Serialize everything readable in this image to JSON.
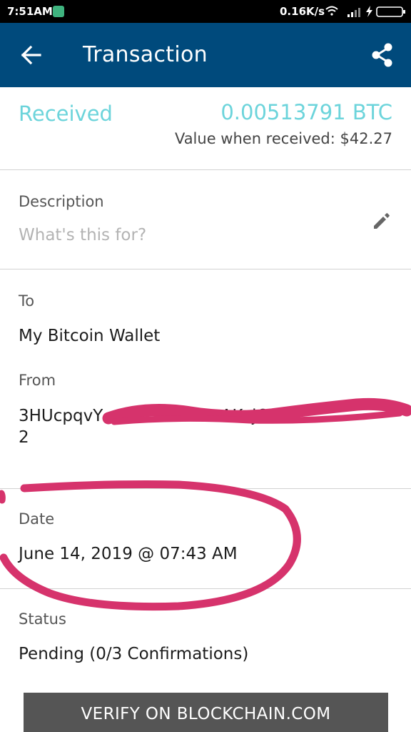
{
  "status_bar": {
    "time": "7:51AM",
    "network_speed": "0.16K/s",
    "icons": [
      "wifi-icon",
      "signal-icon",
      "charging-icon",
      "battery-icon"
    ]
  },
  "app_bar": {
    "title": "Transaction",
    "back_icon": "arrow-left-icon",
    "share_icon": "share-icon",
    "color": "#004a7c"
  },
  "summary": {
    "direction": "Received",
    "amount": "0.00513791 BTC",
    "value_when_received": "Value when received: $42.27",
    "accent_color": "#6cd4db"
  },
  "description": {
    "label": "Description",
    "placeholder": "What's this for?",
    "edit_icon": "pencil-icon"
  },
  "to": {
    "label": "To",
    "value": "My Bitcoin Wallet"
  },
  "from": {
    "label": "From",
    "address_line1": "3HUcpqvY                                    AKcjQnzF",
    "address_line2": "2"
  },
  "date": {
    "label": "Date",
    "value": "June 14, 2019 @ 07:43 AM"
  },
  "status": {
    "label": "Status",
    "value": "Pending (0/3 Confirmations)"
  },
  "verify_button": {
    "label": "VERIFY ON BLOCKCHAIN.COM"
  },
  "annotation_color": "#d6336c"
}
